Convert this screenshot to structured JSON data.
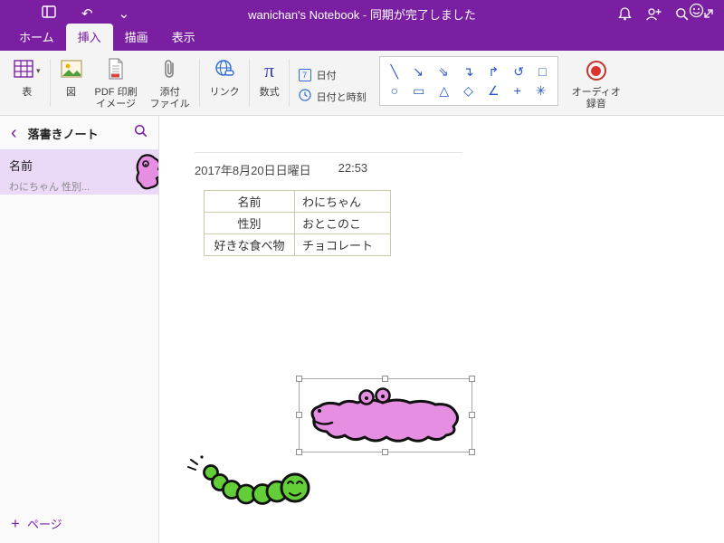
{
  "colors": {
    "accent_purple": "#7a1fa2",
    "ribbon_bg": "#f4f4f4",
    "selected_page_bg": "#ead9f7",
    "shape_blue": "#2456c8",
    "link_blue": "#2b6cd4",
    "record_red": "#d9352f",
    "table_border": "#d0c8ae",
    "croc_pink": "#e58ee2",
    "worm_green": "#63ce37"
  },
  "titlebar": {
    "title": "wanichan's Notebook - 同期が完了しました"
  },
  "tabs": [
    {
      "label": "ホーム"
    },
    {
      "label": "挿入"
    },
    {
      "label": "描画"
    },
    {
      "label": "表示"
    }
  ],
  "ribbon": {
    "table": {
      "label": "表"
    },
    "picture": {
      "label": "図"
    },
    "pdf": {
      "line1": "PDF 印刷",
      "line2": "イメージ"
    },
    "attach": {
      "line1": "添付",
      "line2": "ファイル"
    },
    "link": {
      "label": "リンク"
    },
    "equation": {
      "label": "数式",
      "pi": "π"
    },
    "date": {
      "label": "日付",
      "icon_digit": "7"
    },
    "datetime": {
      "label": "日付と時刻"
    },
    "shapes": {
      "row1": [
        "╲",
        "↘",
        "⇘",
        "↴",
        "↱",
        "↺",
        "□"
      ],
      "row2": [
        "○",
        "▭",
        "△",
        "◇",
        "∠",
        "+",
        "✳"
      ]
    },
    "audio": {
      "line1": "オーディオ",
      "line2": "録音"
    }
  },
  "sidebar": {
    "notebook_title": "落書きノート",
    "pages": [
      {
        "title": "名前",
        "subtitle": "わにちゃん 性別..."
      }
    ],
    "add_page_label": "ページ"
  },
  "content": {
    "date": "2017年8月20日日曜日",
    "time": "22:53",
    "table": {
      "rows": [
        [
          "名前",
          "わにちゃん"
        ],
        [
          "性別",
          "おとこのこ"
        ],
        [
          "好きな食べ物",
          "チョコレート"
        ]
      ]
    }
  },
  "icons": {
    "undo": "↶",
    "chevron_down": "⌄",
    "dropdown": "▾",
    "back": "‹",
    "plus": "+"
  }
}
